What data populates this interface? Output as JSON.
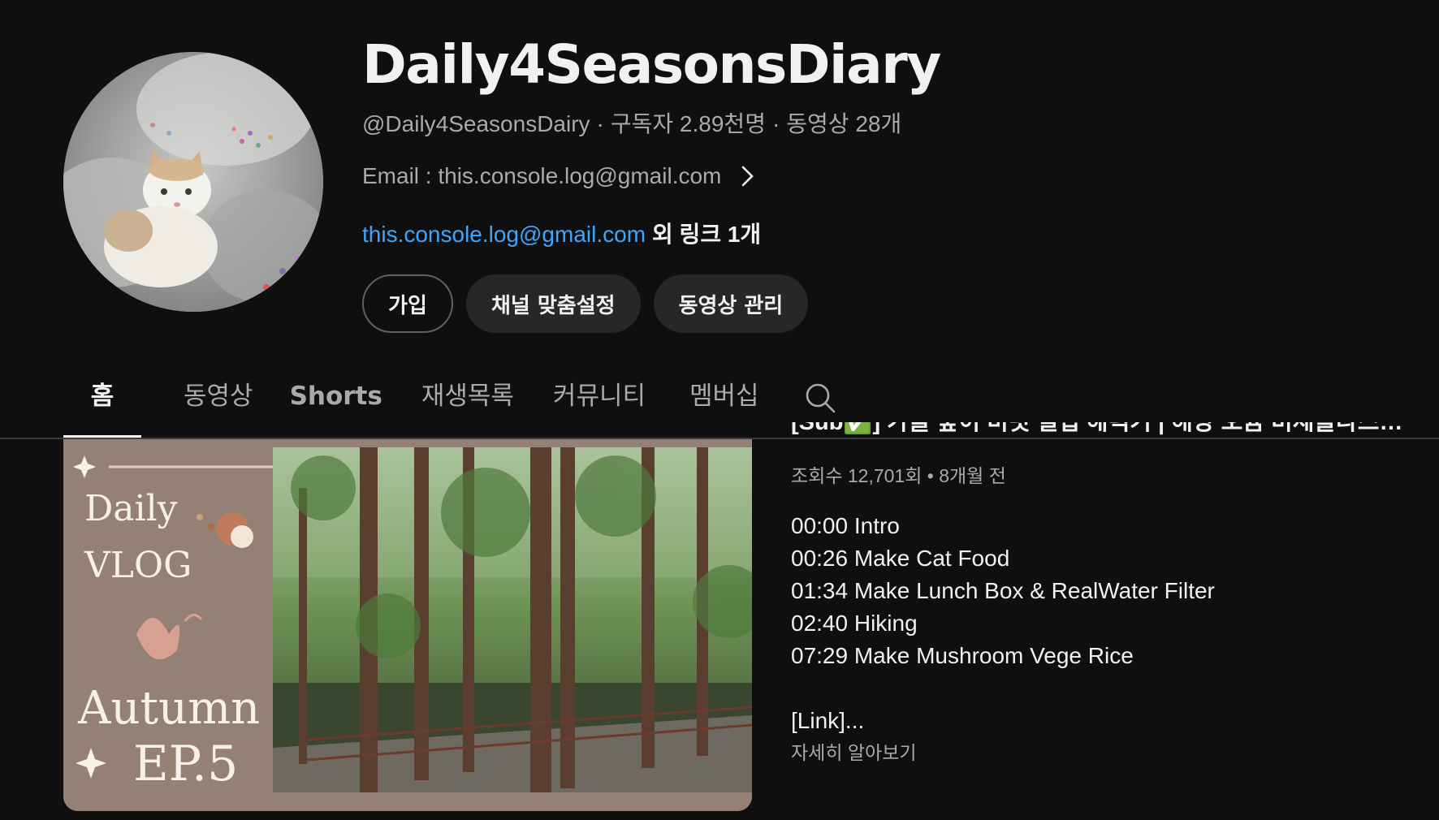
{
  "channel": {
    "title": "Daily4SeasonsDiary",
    "handle": "@Daily4SeasonsDairy",
    "subscribers": "구독자 2.89천명",
    "videos": "동영상 28개",
    "about": "Email : this.console.log@gmail.com",
    "link_text": "this.console.log@gmail.com",
    "link_more": "외 링크 1개"
  },
  "buttons": {
    "join": "가입",
    "customize": "채널 맞춤설정",
    "manage": "동영상 관리"
  },
  "tabs": [
    {
      "label": "홈",
      "active": true
    },
    {
      "label": "동영상",
      "active": false
    },
    {
      "label": "Shorts",
      "active": false
    },
    {
      "label": "재생목록",
      "active": false
    },
    {
      "label": "커뮤니티",
      "active": false
    },
    {
      "label": "멤버십",
      "active": false
    }
  ],
  "featured": {
    "title": "[Sub✅] 가을 숲이 비릿 필립 해력기 | 해상 오늄 미세플라스틱 값이 생...",
    "stats": "조회수 12,701회 • 8개월 전",
    "description": [
      "00:00 Intro",
      "00:26 Make Cat Food",
      "01:34 Make Lunch Box & RealWater Filter",
      "02:40 Hiking",
      "07:29 Make Mushroom Vege Rice"
    ],
    "description_link": "[Link]...",
    "read_more": "자세히 알아보기",
    "thumbnail": {
      "line1": "Daily",
      "line2": "VLOG",
      "line3": "Autumn",
      "line4": "EP.5"
    }
  },
  "icons": {
    "search": "search-icon",
    "chevron": "chevron-right-icon"
  },
  "colors": {
    "background": "#0f0f0f",
    "link": "#3ea6ff",
    "secondary_text": "#aaaaaa",
    "button_bg": "#272727"
  }
}
